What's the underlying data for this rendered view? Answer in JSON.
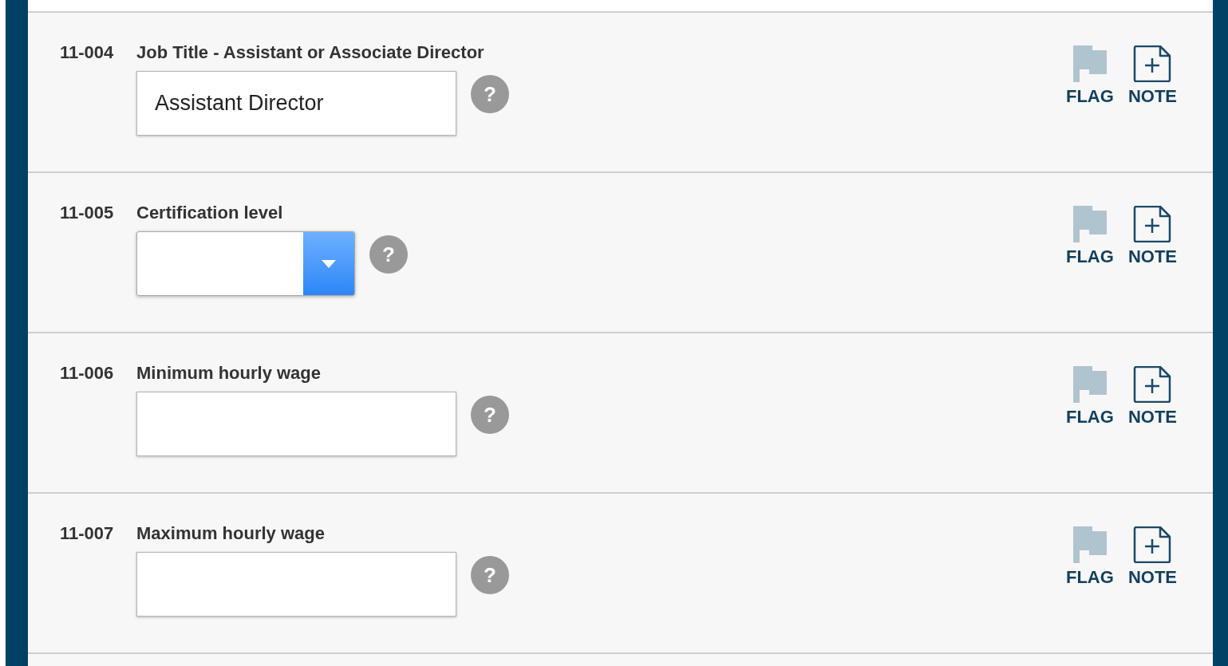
{
  "questions": [
    {
      "number": "11-004",
      "label": "Job Title - Assistant or Associate Director",
      "kind": "text",
      "value": "Assistant Director",
      "help": "?",
      "flag_label": "FLAG",
      "flagged": false,
      "note_label": "NOTE"
    },
    {
      "number": "11-005",
      "label": "Certification level",
      "kind": "select",
      "help": "?",
      "flag_label": "FLAG",
      "flagged": false,
      "note_label": "NOTE"
    },
    {
      "number": "11-006",
      "label": "Minimum hourly wage",
      "kind": "text",
      "help": "?",
      "flag_label": "FLAG",
      "flagged": false,
      "note_label": "NOTE"
    },
    {
      "number": "11-007",
      "label": "Maximum hourly wage",
      "kind": "text",
      "help": "?",
      "flag_label": "FLAG",
      "flagged": false,
      "note_label": "NOTE"
    }
  ]
}
